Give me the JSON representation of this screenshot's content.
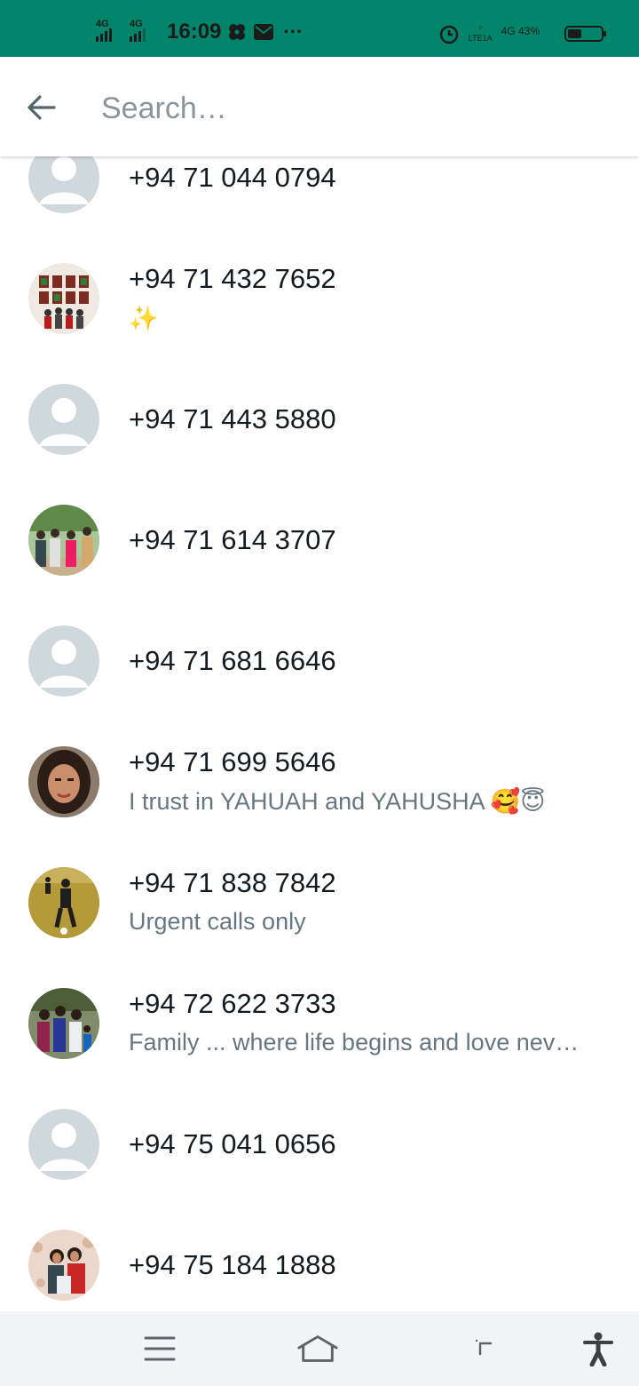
{
  "status_bar": {
    "sim1_label": "4G",
    "sim2_label": "4G",
    "time": "16:09",
    "more": "···",
    "net_label_top": "4G",
    "lte_label": "LTE1A",
    "battery_percent_text": "43%",
    "battery_level": 0.43,
    "icons": [
      "signal-icon",
      "pinwheel-icon",
      "mail-icon",
      "alarm-icon",
      "lte-icon",
      "battery-icon"
    ]
  },
  "search": {
    "placeholder": "Search…",
    "value": ""
  },
  "contacts": [
    {
      "name": "+94 71 044 0794",
      "status": "",
      "avatar": "default"
    },
    {
      "name": "+94 71 432 7652",
      "status": "✨",
      "avatar": "photo-gallery"
    },
    {
      "name": "+94 71 443 5880",
      "status": "",
      "avatar": "default"
    },
    {
      "name": "+94 71 614 3707",
      "status": "",
      "avatar": "photo-group-outdoor"
    },
    {
      "name": "+94 71 681 6646",
      "status": "",
      "avatar": "default"
    },
    {
      "name": "+94 71 699 5646",
      "status": "I trust in YAHUAH and YAHUSHA 🥰😇",
      "avatar": "photo-portrait"
    },
    {
      "name": "+94 71 838 7842",
      "status": "Urgent calls only",
      "avatar": "photo-sports"
    },
    {
      "name": "+94 72 622 3733",
      "status": "Family ... where life begins and love nev…",
      "avatar": "photo-family"
    },
    {
      "name": "+94 75 041 0656",
      "status": "",
      "avatar": "default"
    },
    {
      "name": "+94 75 184 1888",
      "status": "",
      "avatar": "photo-couple"
    }
  ],
  "nav": {
    "items": [
      "menu-icon",
      "home-icon",
      "back-icon",
      "accessibility-icon"
    ]
  },
  "colors": {
    "status_bar": "#00846a",
    "text_primary": "#111b21",
    "text_secondary": "#667781",
    "avatar_default": "#cfd8dc",
    "nav_bar": "#f3f4f8"
  }
}
